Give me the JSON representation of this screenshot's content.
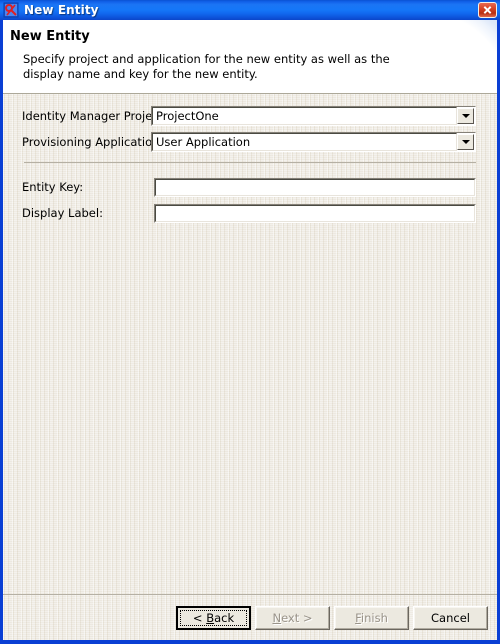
{
  "window": {
    "title": "New Entity",
    "icon": "entity-icon",
    "close_label": "Close",
    "close_icon": "close-icon",
    "accent_color": "#1577f8",
    "close_color": "#d94526",
    "body_color": "#ece8df"
  },
  "header": {
    "title": "New Entity",
    "description": "Specify project and application for the new entity as well as the display name and key for the new entity."
  },
  "form": {
    "fields": [
      {
        "label": "Identity Manager Project:",
        "type": "combo",
        "value": "ProjectOne",
        "icon": "chevron-down-icon"
      },
      {
        "label": "Provisioning Application:",
        "type": "combo",
        "value": "User Application",
        "icon": "chevron-down-icon"
      },
      {
        "label": "Entity Key:",
        "type": "text",
        "value": "",
        "placeholder": ""
      },
      {
        "label": "Display Label:",
        "type": "text",
        "value": "",
        "placeholder": ""
      }
    ]
  },
  "buttons": {
    "back": {
      "label": "< Back",
      "prefix": "< ",
      "accel": "B",
      "rest": "ack",
      "state": "default"
    },
    "next": {
      "label": "Next >",
      "prefix": "",
      "accel": "N",
      "rest": "ext >",
      "state": "disabled"
    },
    "finish": {
      "label": "Finish",
      "prefix": "",
      "accel": "F",
      "rest": "inish",
      "state": "disabled"
    },
    "cancel": {
      "label": "Cancel",
      "state": "enabled"
    }
  }
}
